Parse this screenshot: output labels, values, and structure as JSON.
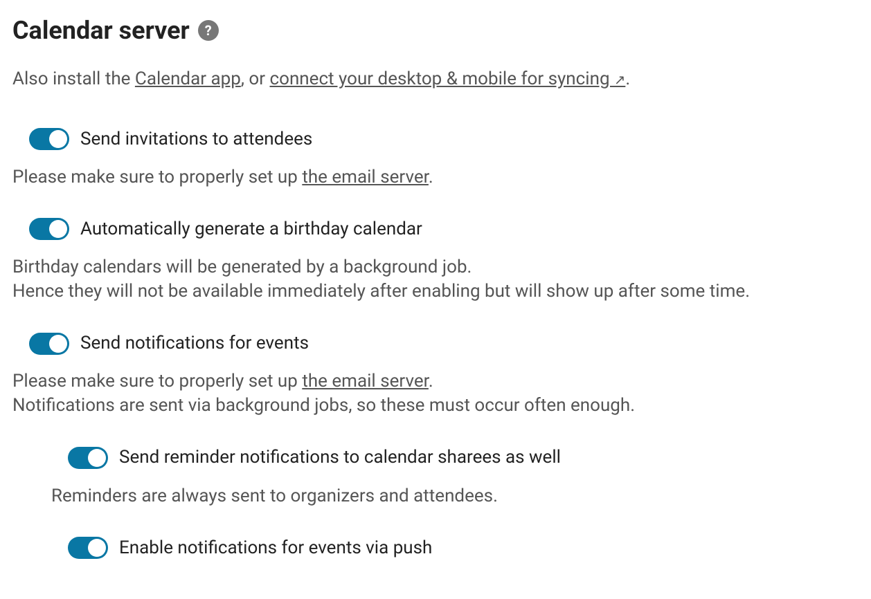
{
  "header": {
    "title": "Calendar server"
  },
  "intro": {
    "prefix": "Also install the ",
    "link1": "Calendar app",
    "mid": ", or ",
    "link2": "connect your desktop & mobile for syncing ",
    "arrow": "↗",
    "suffix": "."
  },
  "settings": {
    "invitations": {
      "label": "Send invitations to attendees",
      "on": true,
      "desc_prefix": "Please make sure to properly set up ",
      "desc_link": "the email server",
      "desc_suffix": "."
    },
    "birthday": {
      "label": "Automatically generate a birthday calendar",
      "on": true,
      "desc_line1": "Birthday calendars will be generated by a background job.",
      "desc_line2": "Hence they will not be available immediately after enabling but will show up after some time."
    },
    "notifications": {
      "label": "Send notifications for events",
      "on": true,
      "desc_prefix": "Please make sure to properly set up ",
      "desc_link": "the email server",
      "desc_suffix": ".",
      "desc_line2": "Notifications are sent via background jobs, so these must occur often enough."
    },
    "sharees": {
      "label": "Send reminder notifications to calendar sharees as well",
      "on": true,
      "desc": "Reminders are always sent to organizers and attendees."
    },
    "push": {
      "label": "Enable notifications for events via push",
      "on": true
    }
  }
}
